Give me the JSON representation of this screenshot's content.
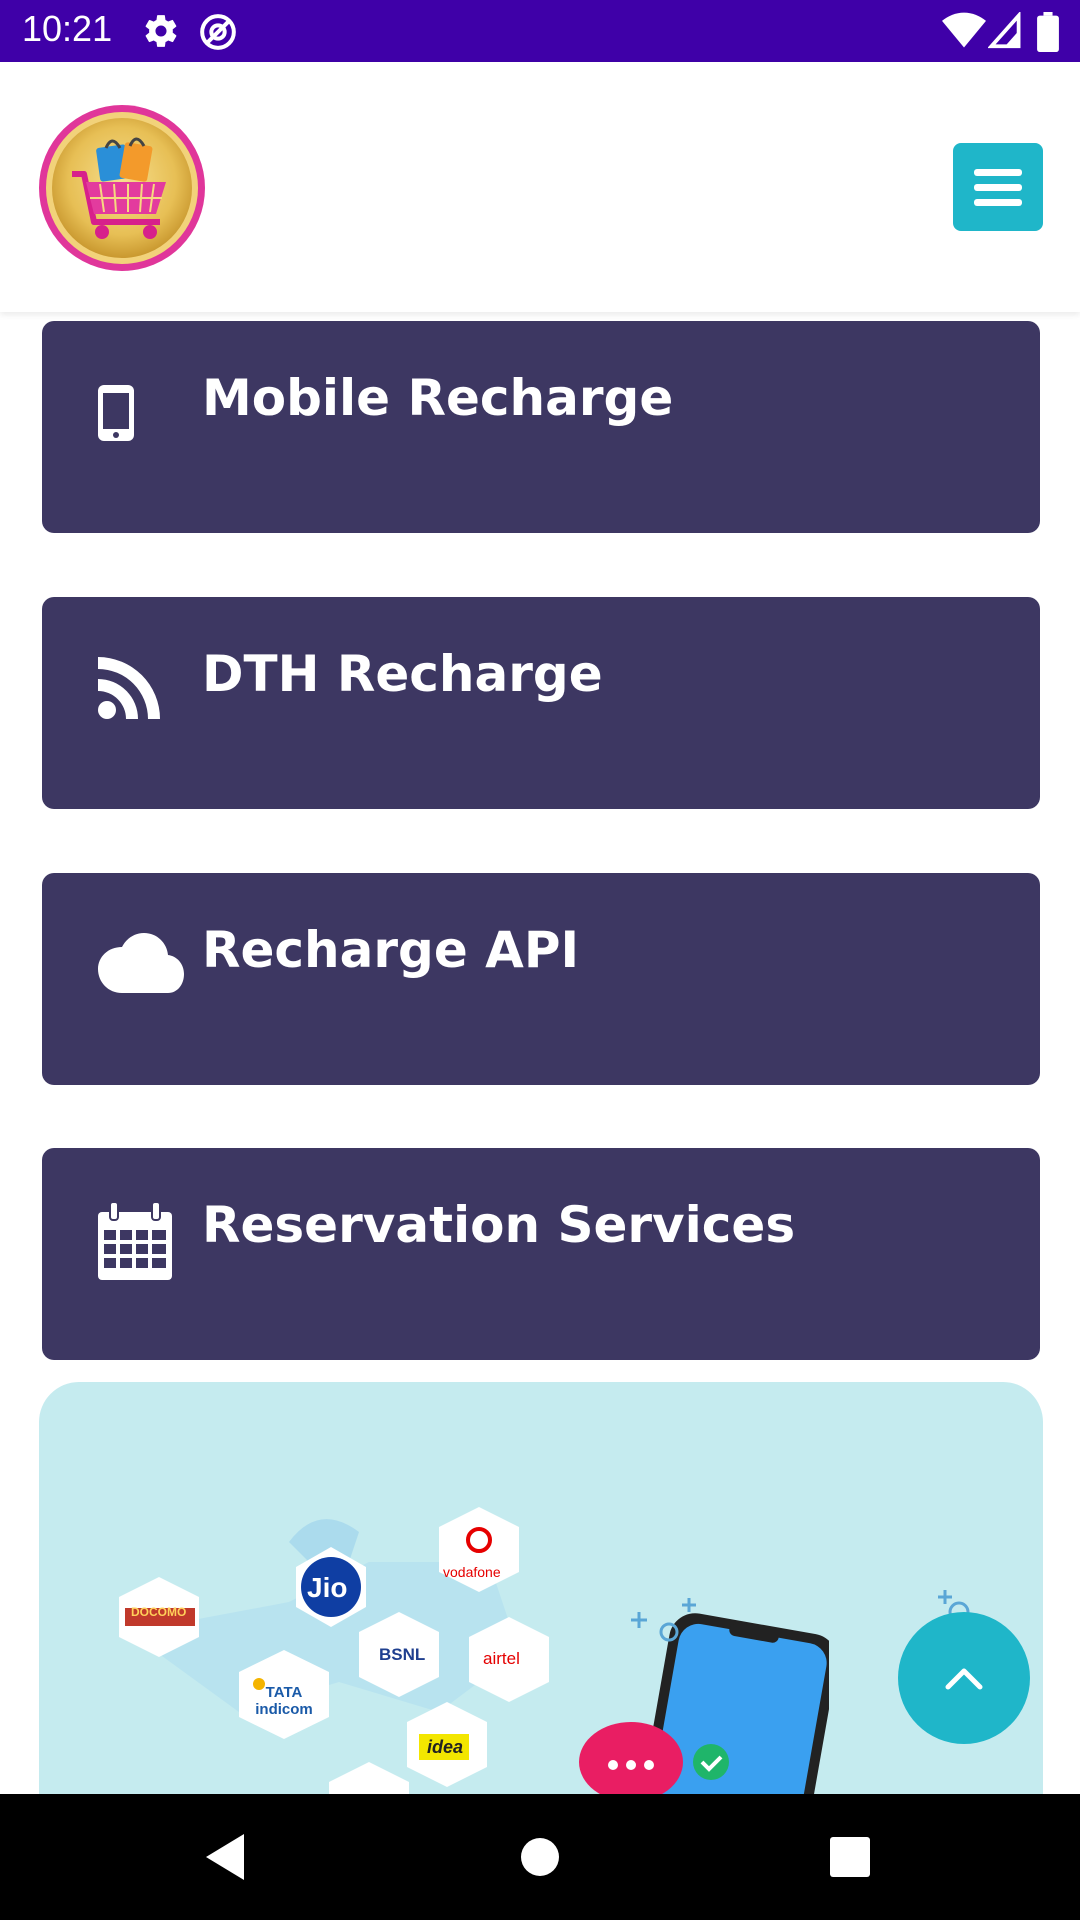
{
  "status_bar": {
    "time": "10:21",
    "icons": [
      "settings-icon",
      "data-saver-icon",
      "wifi-icon",
      "cell-signal-icon",
      "battery-icon"
    ]
  },
  "header": {
    "logo": "shopping-cart-logo",
    "menu_icon": "hamburger-menu-icon",
    "menu_color": "#1fb6c9"
  },
  "services": [
    {
      "label": "Mobile Recharge",
      "icon": "mobile-phone-icon"
    },
    {
      "label": "DTH Recharge",
      "icon": "rss-feed-icon"
    },
    {
      "label": "Recharge API",
      "icon": "cloud-icon"
    },
    {
      "label": "Reservation Services",
      "icon": "calendar-icon"
    }
  ],
  "card_color": "#3d3762",
  "banner": {
    "background": "#c5ebef",
    "operators": [
      "DOCOMO",
      "Jio",
      "vodafone",
      "BSNL",
      "airtel",
      "TATA indicom",
      "idea"
    ]
  },
  "fab": {
    "icon": "chevron-up-icon"
  },
  "nav_bar": {
    "icons": [
      "back-icon",
      "home-icon",
      "recents-icon"
    ]
  }
}
